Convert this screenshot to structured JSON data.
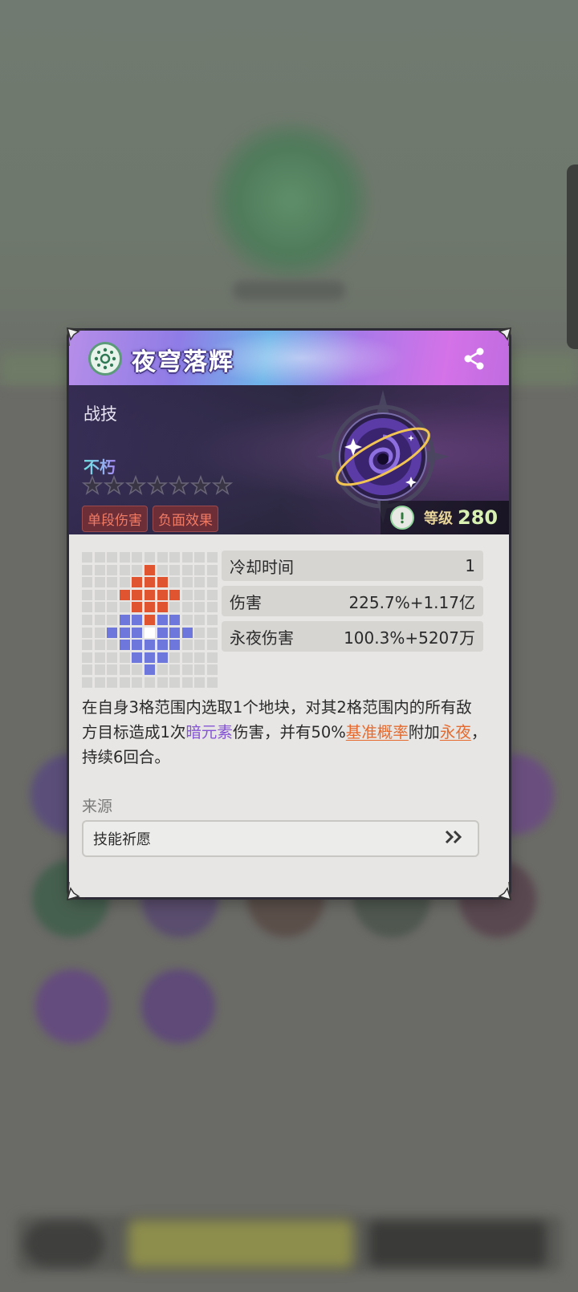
{
  "skill": {
    "title": "夜穹落辉",
    "type": "战技",
    "rank": "不朽",
    "stars_total": 7,
    "stars_filled": 0,
    "tags": [
      "单段伤害",
      "负面效果"
    ],
    "level_label": "等级",
    "level_value": "280"
  },
  "stats": [
    {
      "label": "冷却时间",
      "value": "1"
    },
    {
      "label": "伤害",
      "value": "225.7%+1.17亿"
    },
    {
      "label": "永夜伤害",
      "value": "100.3%+5207万"
    }
  ],
  "description": {
    "p1": "在自身3格范围内选取1个地块，对其2格范围内的所有敌方目标造成1次",
    "element": "暗元素",
    "p2": "伤害，并有50%",
    "chance": "基准概率",
    "p3": "附加",
    "effect": "永夜",
    "p4": "，持续6回合。"
  },
  "source": {
    "label": "来源",
    "button_label": "技能祈愿"
  },
  "range_grid": {
    "size": 11,
    "red": [
      [
        1,
        5
      ],
      [
        2,
        4
      ],
      [
        2,
        5
      ],
      [
        2,
        6
      ],
      [
        3,
        3
      ],
      [
        3,
        4
      ],
      [
        3,
        5
      ],
      [
        3,
        6
      ],
      [
        3,
        7
      ],
      [
        4,
        4
      ],
      [
        4,
        5
      ],
      [
        4,
        6
      ],
      [
        5,
        5
      ]
    ],
    "blue": [
      [
        5,
        3
      ],
      [
        5,
        4
      ],
      [
        5,
        6
      ],
      [
        5,
        7
      ],
      [
        6,
        2
      ],
      [
        6,
        3
      ],
      [
        6,
        4
      ],
      [
        6,
        6
      ],
      [
        6,
        7
      ],
      [
        6,
        8
      ],
      [
        7,
        3
      ],
      [
        7,
        4
      ],
      [
        7,
        5
      ],
      [
        7,
        6
      ],
      [
        7,
        7
      ],
      [
        8,
        4
      ],
      [
        8,
        5
      ],
      [
        8,
        6
      ],
      [
        9,
        5
      ]
    ],
    "white": [
      [
        6,
        5
      ]
    ]
  },
  "colors": {
    "accent_red": "#e0542f",
    "accent_blue": "#6e78dc",
    "element_purple": "#8655d3",
    "keyword_orange": "#e6692d"
  },
  "icons": {
    "badge": "skill-tree-icon",
    "share": "share-icon",
    "level": "exclamation-icon",
    "source_arrow": "double-chevron-right-icon"
  }
}
